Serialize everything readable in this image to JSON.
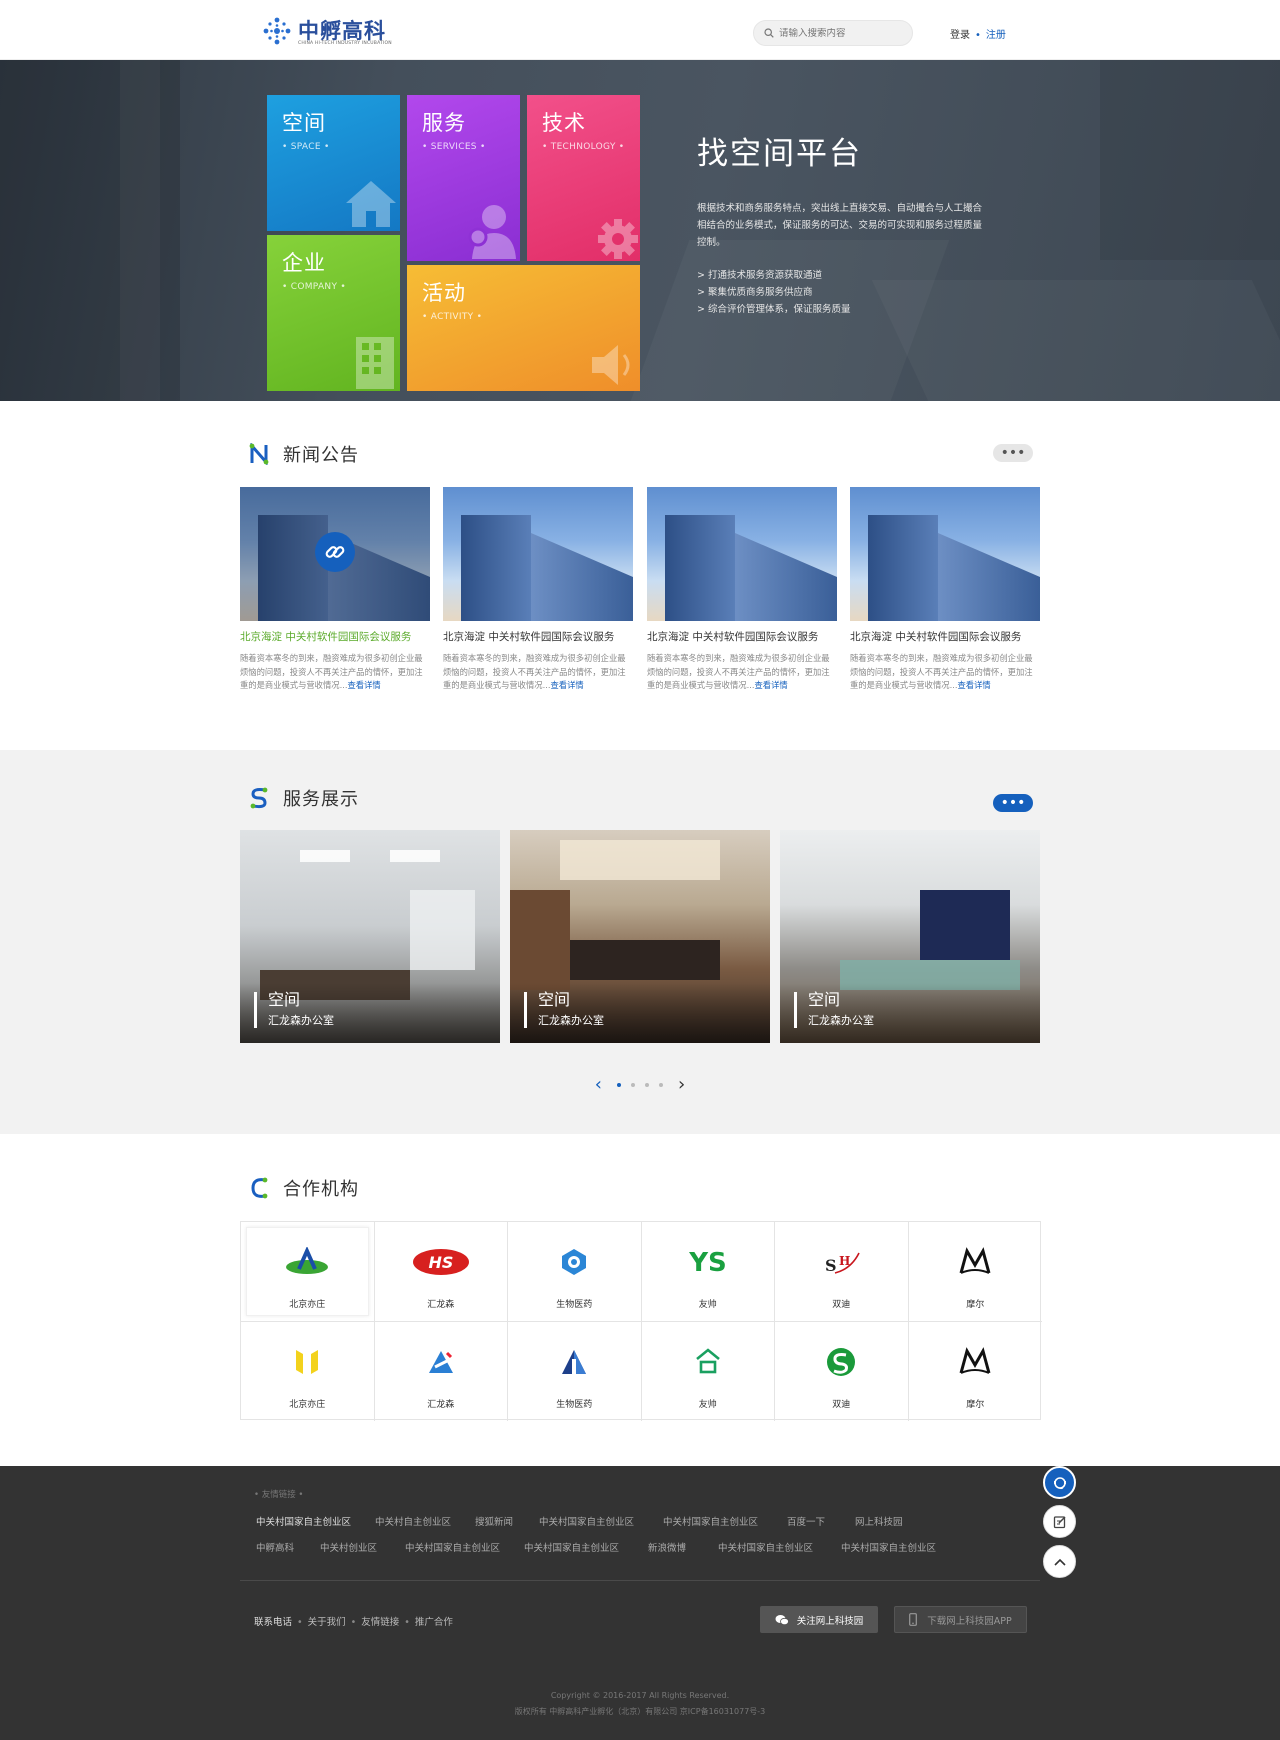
{
  "header": {
    "logo_name": "中孵高科",
    "logo_sub": "CHINA HI-TECH INDUSTRY INCUBATION",
    "search_placeholder": "请输入搜索内容",
    "login": "登录",
    "register": "注册",
    "accent": "#1560bd"
  },
  "hero": {
    "tiles": [
      {
        "title": "空间",
        "sub": "• SPACE •",
        "color": "#1b8fd6",
        "icon": "house-icon"
      },
      {
        "title": "服务",
        "sub": "• SERVICES •",
        "color": "#a03be3",
        "icon": "person-icon"
      },
      {
        "title": "技术",
        "sub": "• TECHNOLOGY •",
        "color": "#ec3e78",
        "icon": "gear-icon"
      },
      {
        "title": "企业",
        "sub": "• COMPANY •",
        "color": "#72c22a",
        "icon": "building-icon"
      },
      {
        "title": "活动",
        "sub": "• ACTIVITY •",
        "color": "#f0a72c",
        "icon": "speaker-icon"
      }
    ],
    "title": "找空间平台",
    "desc": "根据技术和商务服务特点，突出线上直接交易、自动撮合与人工撮合相结合的业务模式，保证服务的可达、交易的可实现和服务过程质量控制。",
    "bullets": [
      "> 打通技术服务资源获取通道",
      "> 聚集优质商务服务供应商",
      "> 综合评价管理体系，保证服务质量"
    ]
  },
  "news": {
    "title": "新闻公告",
    "more": "•••",
    "items": [
      {
        "title": "北京海淀  中关村软件园国际会议服务",
        "desc": "随着资本寒冬的到来，融资难成为很多初创企业最烦恼的问题，投资人不再关注产品的情怀，更加注重的是商业模式与营收情况...",
        "more": "查看详情",
        "active": true
      },
      {
        "title": "北京海淀  中关村软件园国际会议服务",
        "desc": "随着资本寒冬的到来，融资难成为很多初创企业最烦恼的问题，投资人不再关注产品的情怀，更加注重的是商业模式与营收情况...",
        "more": "查看详情"
      },
      {
        "title": "北京海淀  中关村软件园国际会议服务",
        "desc": "随着资本寒冬的到来，融资难成为很多初创企业最烦恼的问题，投资人不再关注产品的情怀，更加注重的是商业模式与营收情况...",
        "more": "查看详情"
      },
      {
        "title": "北京海淀  中关村软件园国际会议服务",
        "desc": "随着资本寒冬的到来，融资难成为很多初创企业最烦恼的问题，投资人不再关注产品的情怀，更加注重的是商业模式与营收情况...",
        "more": "查看详情"
      }
    ],
    "active_color": "#5aaa2a"
  },
  "services": {
    "title": "服务展示",
    "more": "•••",
    "items": [
      {
        "title": "空间",
        "sub": "汇龙森办公室"
      },
      {
        "title": "空间",
        "sub": "汇龙森办公室"
      },
      {
        "title": "空间",
        "sub": "汇龙森办公室"
      }
    ],
    "pager_prev": "‹",
    "pager_next": "›",
    "pages": 4,
    "current_page": 1
  },
  "partners": {
    "title": "合作机构",
    "items": [
      {
        "name": "北京亦庄",
        "logo": "yizhuang-logo"
      },
      {
        "name": "汇龙森",
        "logo": "hs-logo"
      },
      {
        "name": "生物医药",
        "logo": "bio-logo"
      },
      {
        "name": "友帅",
        "logo": "ys-logo"
      },
      {
        "name": "双迪",
        "logo": "sh-logo"
      },
      {
        "name": "摩尔",
        "logo": "ma-logo"
      },
      {
        "name": "北京亦庄",
        "logo": "yellow-bars-logo"
      },
      {
        "name": "汇龙森",
        "logo": "star-logo"
      },
      {
        "name": "生物医药",
        "logo": "tower-logo"
      },
      {
        "name": "友帅",
        "logo": "he-logo"
      },
      {
        "name": "双迪",
        "logo": "green-s-logo"
      },
      {
        "name": "摩尔",
        "logo": "ma-logo"
      }
    ]
  },
  "footer": {
    "links_title": "• 友情链接 •",
    "row1": [
      "中关村国家自主创业区",
      "中关村自主创业区",
      "搜狐新闻",
      "中关村国家自主创业区",
      "中关村国家自主创业区",
      "百度一下",
      "网上科技园"
    ],
    "row2": [
      "中孵高科",
      "中关村创业区",
      "中关村国家自主创业区",
      "中关村国家自主创业区",
      "新浪微博",
      "中关村国家自主创业区",
      "中关村国家自主创业区"
    ],
    "bottom_links": [
      "联系电话",
      "关于我们",
      "友情链接",
      "推广合作"
    ],
    "wechat_btn": "关注网上科技园",
    "app_btn": "下载网上科技园APP",
    "copyright": "Copyright © 2016-2017 All Rights Reserved.",
    "icp": "版权所有 中孵高科产业孵化（北京）有限公司  京ICP备16031077号-3"
  },
  "float": {
    "items": [
      "support-icon",
      "edit-icon",
      "back-to-top-icon"
    ]
  }
}
